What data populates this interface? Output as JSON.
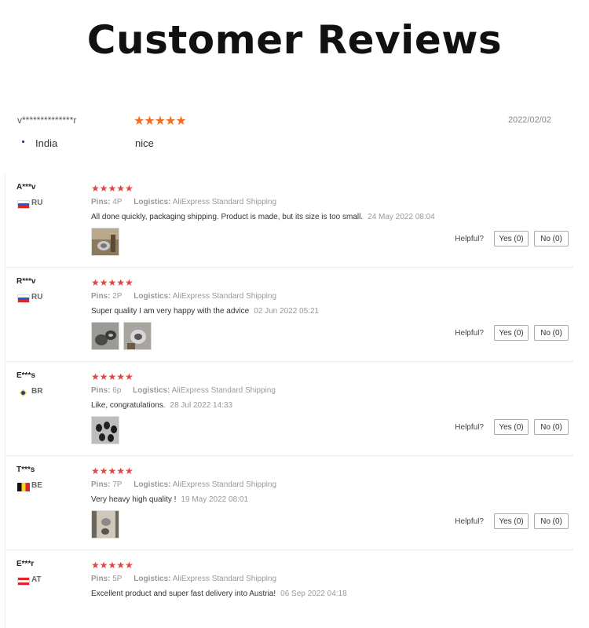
{
  "page": {
    "title": "Customer Reviews"
  },
  "top_review": {
    "user": "v**************r",
    "stars": "★★★★★",
    "date": "2022/02/02",
    "country": "India",
    "text": "nice",
    "flag": "india-flag-icon",
    "star_color": "#f26d21"
  },
  "labels": {
    "pins": "Pins:",
    "logistics": "Logistics:",
    "helpful": "Helpful?",
    "yes": "Yes (0)",
    "no": "No (0)"
  },
  "star_color": "#e64340",
  "reviews": [
    {
      "user": "A***v",
      "country": "RU",
      "flag": "russia-flag-icon",
      "stars": "★★★★★",
      "pins": "4P",
      "logistics": "AliExpress Standard Shipping",
      "text": "All done quickly, packaging shipping. Product is made, but its size is too small.",
      "date": "24 May 2022 08:04",
      "photos": 1
    },
    {
      "user": "R***v",
      "country": "RU",
      "flag": "russia-flag-icon",
      "stars": "★★★★★",
      "pins": "2P",
      "logistics": "AliExpress Standard Shipping",
      "text": "Super quality I am very happy with the advice",
      "date": "02 Jun 2022 05:21",
      "photos": 2
    },
    {
      "user": "E***s",
      "country": "BR",
      "flag": "brazil-flag-icon",
      "stars": "★★★★★",
      "pins": "6p",
      "logistics": "AliExpress Standard Shipping",
      "text": "Like, congratulations.",
      "date": "28 Jul 2022 14:33",
      "photos": 1
    },
    {
      "user": "T***s",
      "country": "BE",
      "flag": "belgium-flag-icon",
      "stars": "★★★★★",
      "pins": "7P",
      "logistics": "AliExpress Standard Shipping",
      "text": "Very heavy high quality !",
      "date": "19 May 2022 08:01",
      "photos": 1
    },
    {
      "user": "E***r",
      "country": "AT",
      "flag": "austria-flag-icon",
      "stars": "★★★★★",
      "pins": "5P",
      "logistics": "AliExpress Standard Shipping",
      "text": "Excellent product and super fast delivery into Austria!",
      "date": "06 Sep 2022 04:18",
      "photos": 0
    }
  ]
}
